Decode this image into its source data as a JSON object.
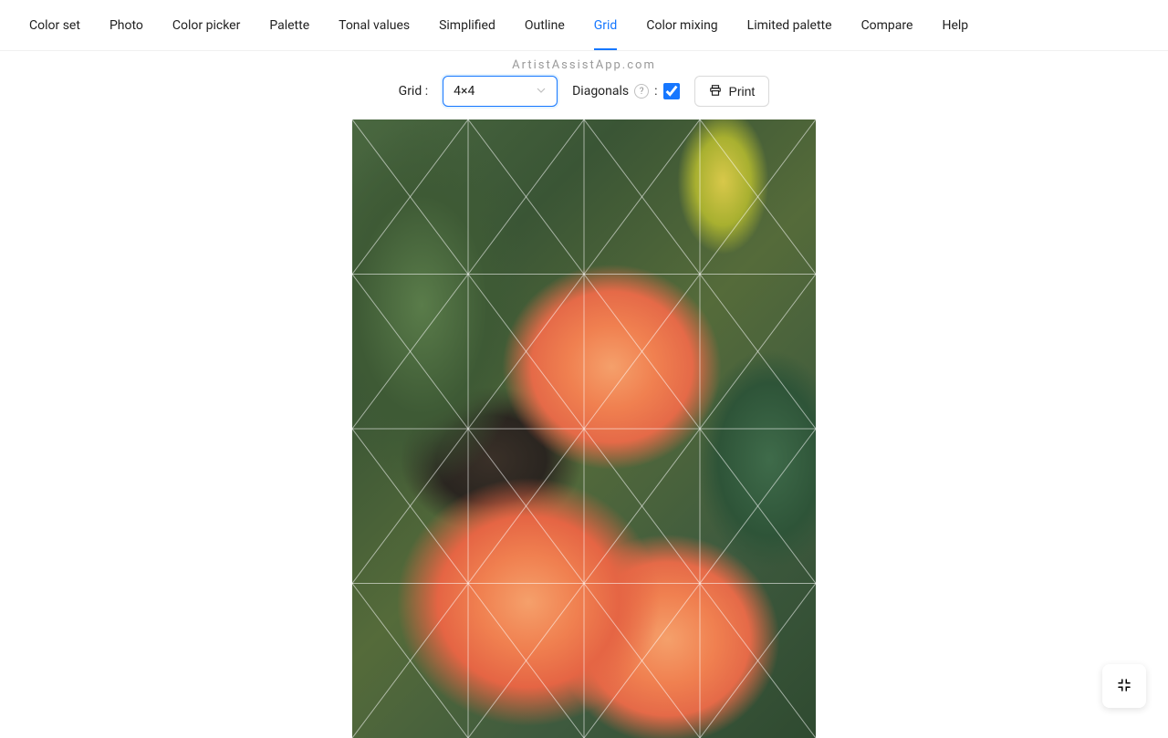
{
  "tabs": {
    "items": [
      {
        "label": "Color set"
      },
      {
        "label": "Photo"
      },
      {
        "label": "Color picker"
      },
      {
        "label": "Palette"
      },
      {
        "label": "Tonal values"
      },
      {
        "label": "Simplified"
      },
      {
        "label": "Outline"
      },
      {
        "label": "Grid"
      },
      {
        "label": "Color mixing"
      },
      {
        "label": "Limited palette"
      },
      {
        "label": "Compare"
      },
      {
        "label": "Help"
      }
    ],
    "active_index": 7
  },
  "watermark": "ArtistAssistApp.com",
  "toolbar": {
    "grid_label": "Grid :",
    "grid_value": "4×4",
    "diagonals_label": "Diagonals",
    "diagonals_colon": ":",
    "diagonals_checked": true,
    "print_label": "Print"
  },
  "grid": {
    "cols": 4,
    "rows": 4,
    "diagonals": true
  }
}
